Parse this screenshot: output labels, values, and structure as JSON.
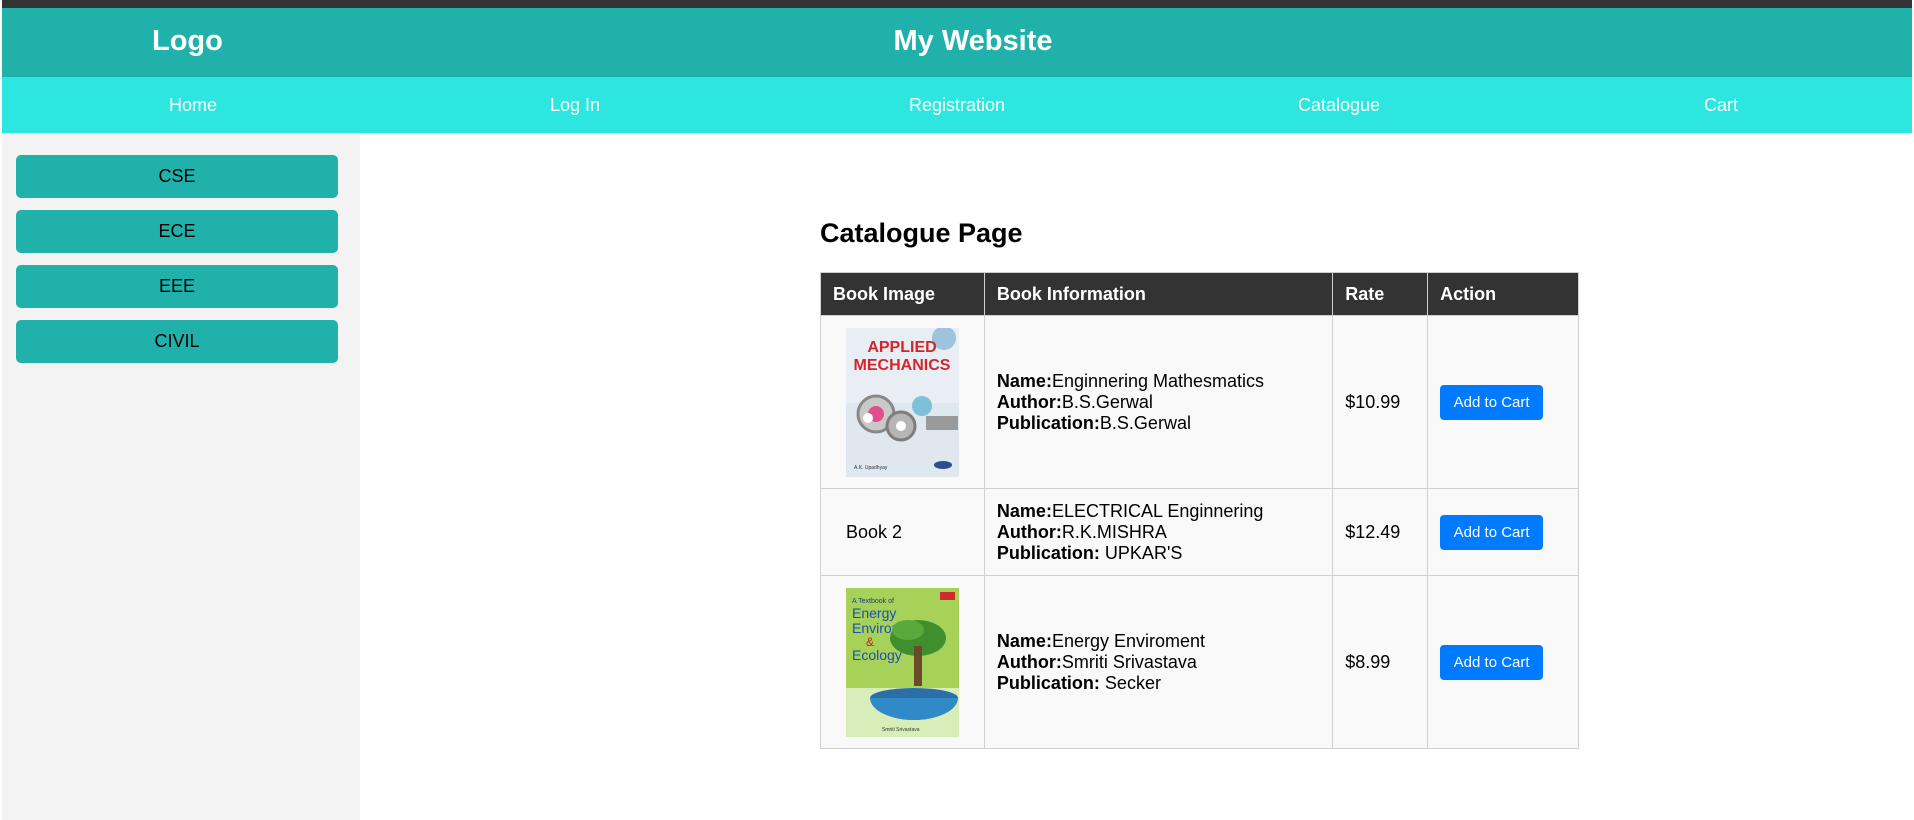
{
  "header": {
    "logo": "Logo",
    "title": "My Website"
  },
  "nav": {
    "items": [
      "Home",
      "Log In",
      "Registration",
      "Catalogue",
      "Cart"
    ]
  },
  "sidebar": {
    "items": [
      "CSE",
      "ECE",
      "EEE",
      "CIVIL"
    ]
  },
  "main": {
    "title": "Catalogue Page",
    "columns": [
      "Book Image",
      "Book Information",
      "Rate",
      "Action"
    ],
    "labels": {
      "name": "Name:",
      "author": "Author:",
      "publication": "Publication:"
    },
    "books": [
      {
        "image": "applied-mechanics-cover",
        "name": "Enginnering Mathesmatics",
        "author": "B.S.Gerwal",
        "publication": "B.S.Gerwal",
        "rate": "$10.99",
        "action": "Add to Cart",
        "cover_text": "APPLIED MECHANICS",
        "cover_author": "A.K. Upadhyay"
      },
      {
        "image_alt": "Book 2",
        "name": "ELECTRICAL Enginnering",
        "author": "R.K.MISHRA",
        "publication": " UPKAR'S",
        "rate": "$12.49",
        "action": "Add to Cart"
      },
      {
        "image": "energy-environment-ecology-cover",
        "name": "Energy Enviroment",
        "author": "Smriti Srivastava",
        "publication": " Secker",
        "rate": "$8.99",
        "action": "Add to Cart",
        "cover_text": "A Textbook of Energy Environment & Ecology",
        "cover_author": "Smriti Srivastava"
      }
    ]
  },
  "colors": {
    "header": "#20b2aa",
    "nav": "#2de6e0",
    "sidebar_bg": "#f3f3f3",
    "table_header": "#333333",
    "button": "#007bff"
  }
}
